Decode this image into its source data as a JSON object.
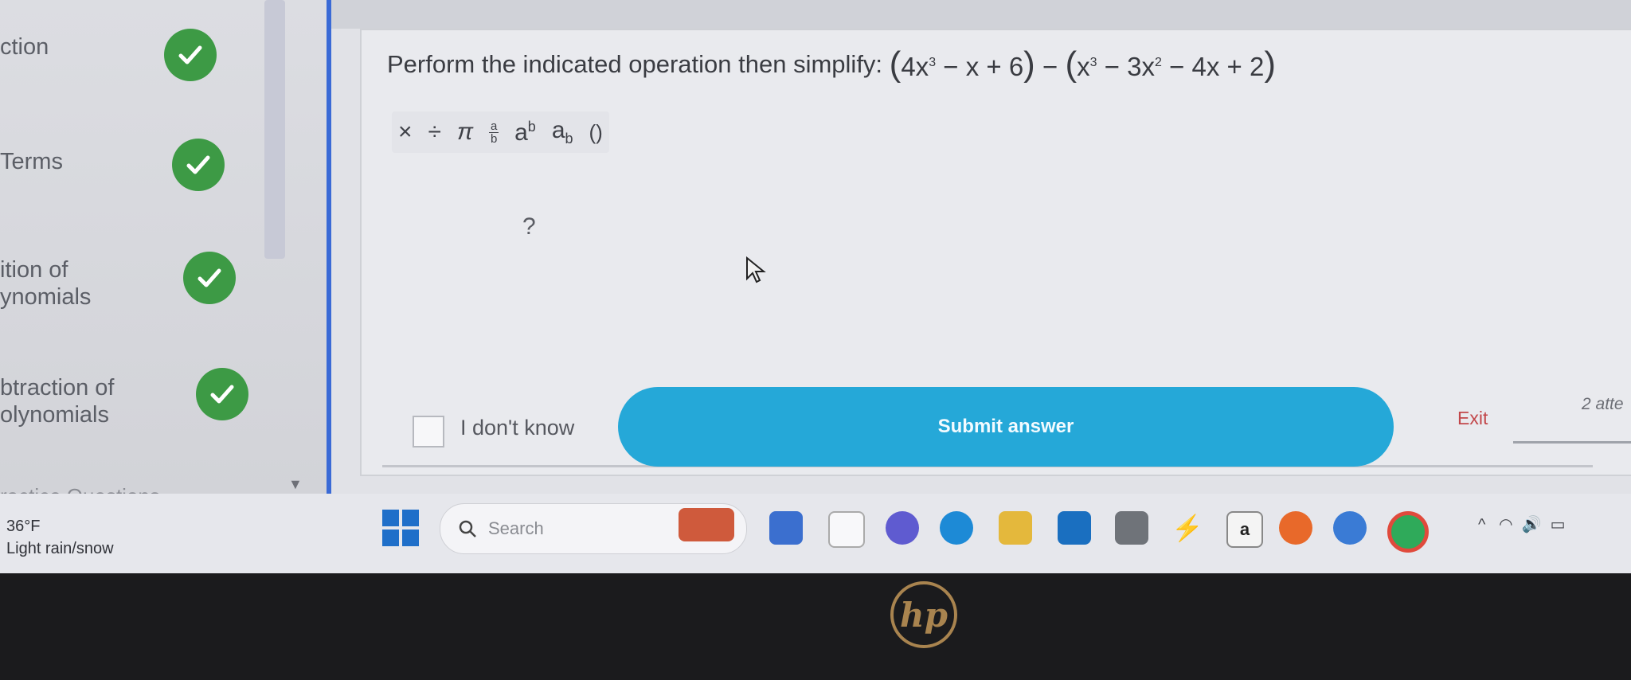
{
  "sidebar": {
    "items": [
      {
        "label_line1": "ction",
        "label_line2": "",
        "status": "complete"
      },
      {
        "label_line1": "Terms",
        "label_line2": "",
        "status": "complete"
      },
      {
        "label_line1": "ition of",
        "label_line2": "ynomials",
        "status": "complete"
      },
      {
        "label_line1": "btraction of",
        "label_line2": "olynomials",
        "status": "complete"
      }
    ],
    "footer_label": "ractice Questions"
  },
  "question": {
    "prompt": "Perform the indicated operation then simplify:",
    "expression": {
      "first": {
        "a": "4x",
        "a_exp": "3",
        "rest": "− x + 6"
      },
      "op": "−",
      "second": {
        "a": "x",
        "a_exp": "3",
        "b": "− 3x",
        "b_exp": "2",
        "rest": "− 4x + 2"
      }
    }
  },
  "toolbar": {
    "times": "×",
    "divide": "÷",
    "pi": "π",
    "frac_num": "a",
    "frac_den": "b",
    "power_base": "a",
    "power_exp": "b",
    "sub_base": "a",
    "sub_idx": "b",
    "parens": "()"
  },
  "answer": {
    "placeholder": "?"
  },
  "actions": {
    "idk_label": "I don't know",
    "submit_label": "Submit answer",
    "exit_label": "Exit",
    "attempts": "2 atte"
  },
  "taskbar": {
    "weather_temp": "36°F",
    "weather_desc": "Light rain/snow",
    "search_placeholder": "Search",
    "amazon_letter": "a"
  },
  "bezel": {
    "logo": "hp"
  },
  "colors": {
    "accent": "#25a8d8",
    "check": "#3d9a45",
    "exit": "#c2474a",
    "panel_border": "#3a6ad6"
  }
}
